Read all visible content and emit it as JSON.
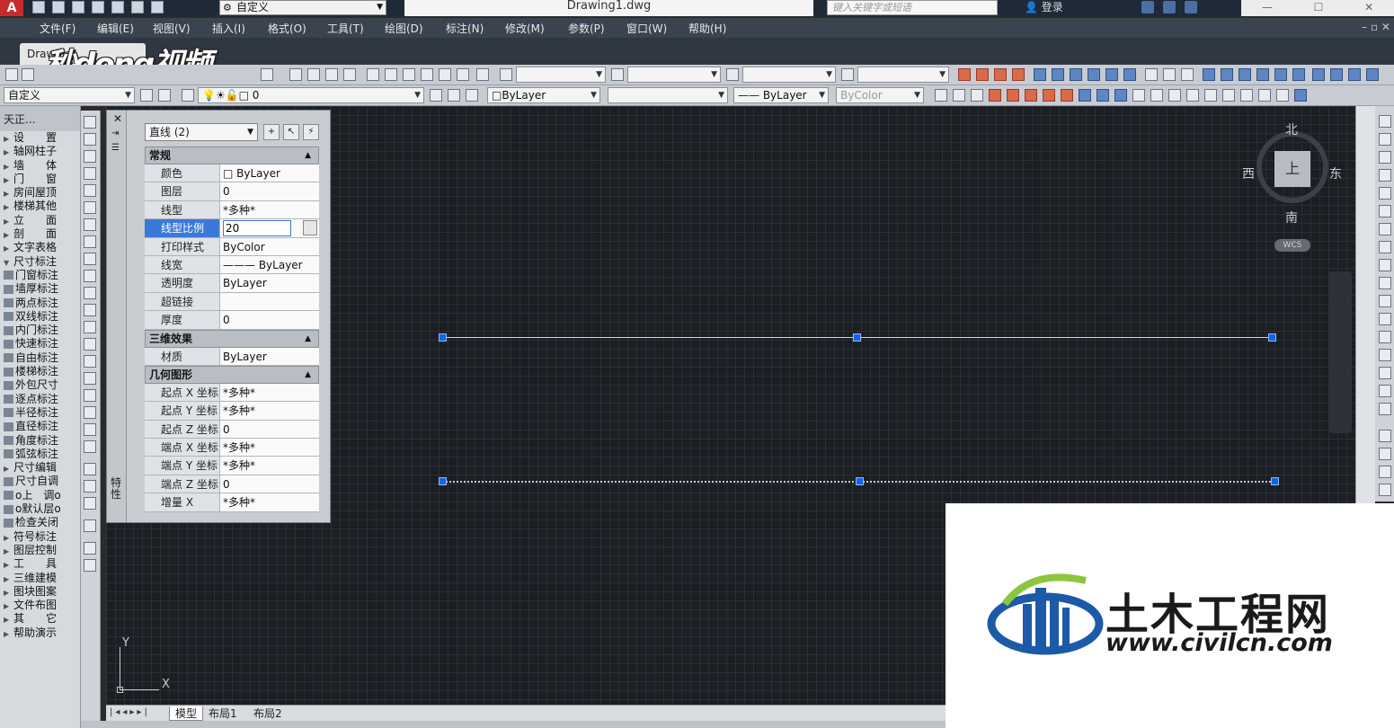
{
  "titlebar": {
    "workspace": "自定义",
    "document_title": "Drawing1.dwg",
    "search_placeholder": "键入关键字或短语",
    "login": "登录"
  },
  "menu": [
    "文件(F)",
    "编辑(E)",
    "视图(V)",
    "插入(I)",
    "格式(O)",
    "工具(T)",
    "绘图(D)",
    "标注(N)",
    "修改(M)",
    "参数(P)",
    "窗口(W)",
    "帮助(H)"
  ],
  "file_tab": "Drawing1",
  "video_watermark": "秒dong视频",
  "toolbar2": {
    "style_combo": "自定义",
    "layer_combo": "0",
    "color_combo": "ByLayer",
    "linetype_combo": "",
    "lineweight_combo": "ByLayer",
    "plotstyle_combo": "ByColor"
  },
  "left_panel": {
    "header": "天正...",
    "items": [
      {
        "label": "设　　置",
        "type": "arrow"
      },
      {
        "label": "轴网柱子",
        "type": "arrow"
      },
      {
        "label": "墙　　体",
        "type": "arrow"
      },
      {
        "label": "门　　窗",
        "type": "arrow"
      },
      {
        "label": "房间屋顶",
        "type": "arrow"
      },
      {
        "label": "楼梯其他",
        "type": "arrow"
      },
      {
        "label": "立　　面",
        "type": "arrow"
      },
      {
        "label": "剖　　面",
        "type": "arrow"
      },
      {
        "label": "文字表格",
        "type": "arrow"
      },
      {
        "label": "尺寸标注",
        "type": "open"
      },
      {
        "label": "门窗标注",
        "type": "icon"
      },
      {
        "label": "墙厚标注",
        "type": "icon"
      },
      {
        "label": "两点标注",
        "type": "icon"
      },
      {
        "label": "双线标注",
        "type": "icon"
      },
      {
        "label": "内门标注",
        "type": "icon"
      },
      {
        "label": "快速标注",
        "type": "icon"
      },
      {
        "label": "自由标注",
        "type": "icon"
      },
      {
        "label": "楼梯标注",
        "type": "icon"
      },
      {
        "label": "外包尺寸",
        "type": "icon"
      },
      {
        "label": "逐点标注",
        "type": "icon"
      },
      {
        "label": "半径标注",
        "type": "icon"
      },
      {
        "label": "直径标注",
        "type": "icon"
      },
      {
        "label": "角度标注",
        "type": "icon"
      },
      {
        "label": "弧弦标注",
        "type": "icon"
      },
      {
        "label": "尺寸编辑",
        "type": "arrow"
      },
      {
        "label": "尺寸自调",
        "type": "icon"
      },
      {
        "label": "o上　调o",
        "type": "icon"
      },
      {
        "label": "o默认层o",
        "type": "icon"
      },
      {
        "label": "检查关闭",
        "type": "icon"
      },
      {
        "label": "符号标注",
        "type": "arrow"
      },
      {
        "label": "图层控制",
        "type": "arrow"
      },
      {
        "label": "工　　具",
        "type": "arrow"
      },
      {
        "label": "三维建模",
        "type": "arrow"
      },
      {
        "label": "图块图案",
        "type": "arrow"
      },
      {
        "label": "文件布图",
        "type": "arrow"
      },
      {
        "label": "其　　它",
        "type": "arrow"
      },
      {
        "label": "帮助演示",
        "type": "arrow"
      }
    ]
  },
  "properties": {
    "selection": "直线 (2)",
    "side_label": "特性",
    "sections": [
      {
        "title": "常规",
        "rows": [
          {
            "label": "颜色",
            "value": "□ ByLayer"
          },
          {
            "label": "图层",
            "value": "0"
          },
          {
            "label": "线型",
            "value": "*多种*"
          },
          {
            "label": "线型比例",
            "value": "20",
            "active": true
          },
          {
            "label": "打印样式",
            "value": "ByColor"
          },
          {
            "label": "线宽",
            "value": "——— ByLayer"
          },
          {
            "label": "透明度",
            "value": "ByLayer"
          },
          {
            "label": "超链接",
            "value": ""
          },
          {
            "label": "厚度",
            "value": "0"
          }
        ]
      },
      {
        "title": "三维效果",
        "rows": [
          {
            "label": "材质",
            "value": "ByLayer"
          }
        ]
      },
      {
        "title": "几何图形",
        "rows": [
          {
            "label": "起点 X 坐标",
            "value": "*多种*"
          },
          {
            "label": "起点 Y 坐标",
            "value": "*多种*"
          },
          {
            "label": "起点 Z 坐标",
            "value": "0"
          },
          {
            "label": "端点 X 坐标",
            "value": "*多种*"
          },
          {
            "label": "端点 Y 坐标",
            "value": "*多种*"
          },
          {
            "label": "端点 Z 坐标",
            "value": "0"
          },
          {
            "label": "增量 X",
            "value": "*多种*"
          }
        ]
      }
    ]
  },
  "viewcube": {
    "north": "北",
    "south": "南",
    "west": "西",
    "east": "东",
    "face": "上",
    "wcs": "WCS"
  },
  "ucs": {
    "x": "X",
    "y": "Y"
  },
  "layout_tabs": [
    "模型",
    "布局1",
    "布局2"
  ],
  "civil_watermark": {
    "name": "土木工程网",
    "url": "www.civilcn.com"
  }
}
